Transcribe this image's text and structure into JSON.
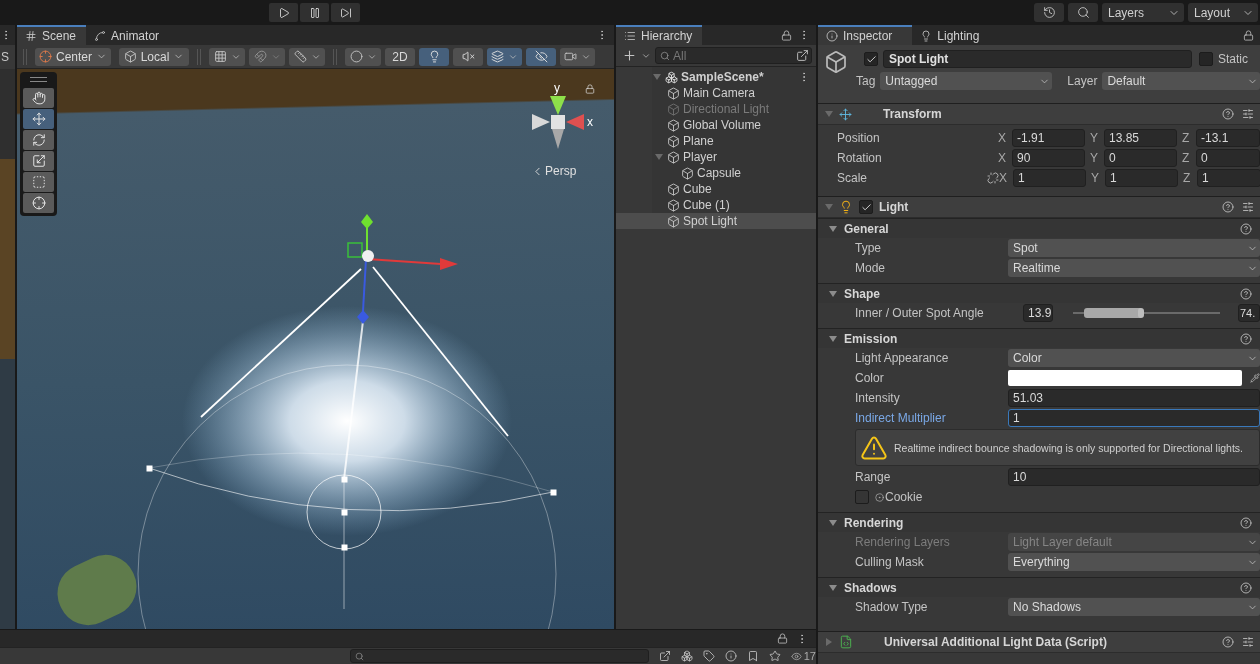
{
  "toolbar": {
    "layers": "Layers",
    "layout": "Layout"
  },
  "left_panel": {
    "tab": "S"
  },
  "scene": {
    "tabs": [
      {
        "label": "Scene",
        "selected": true
      },
      {
        "label": "Animator",
        "selected": false
      }
    ],
    "toolbar": {
      "pivot": "Center",
      "space": "Local",
      "view_2d": {
        "label": "2D",
        "on": false
      },
      "toggles": [
        {
          "kind": "lighting",
          "on": true
        },
        {
          "kind": "audio",
          "on": false
        },
        {
          "kind": "effects",
          "on": true
        },
        {
          "kind": "visibility",
          "on": true
        }
      ]
    },
    "tools": [
      {
        "kind": "hand",
        "selected": false
      },
      {
        "kind": "move",
        "selected": true
      },
      {
        "kind": "rotate",
        "selected": false
      },
      {
        "kind": "scale",
        "selected": false
      },
      {
        "kind": "rect",
        "selected": false
      },
      {
        "kind": "transform",
        "selected": false
      }
    ],
    "gizmo": {
      "y_label": "y",
      "x_label": "x",
      "projection": "Persp"
    }
  },
  "hierarchy": {
    "tab": "Hierarchy",
    "search_placeholder": "All",
    "scene": {
      "name": "SampleScene*",
      "expanded": true
    },
    "items": [
      {
        "label": "Main Camera",
        "disabled": false,
        "selected": false
      },
      {
        "label": "Directional Light",
        "disabled": true,
        "selected": false
      },
      {
        "label": "Global Volume",
        "disabled": false,
        "selected": false
      },
      {
        "label": "Plane",
        "disabled": false,
        "selected": false
      },
      {
        "label": "Player",
        "disabled": false,
        "selected": false,
        "expanded": true,
        "children": [
          {
            "label": "Capsule",
            "disabled": false,
            "selected": false
          }
        ]
      },
      {
        "label": "Cube",
        "disabled": false,
        "selected": false
      },
      {
        "label": "Cube (1)",
        "disabled": false,
        "selected": false
      },
      {
        "label": "Spot Light",
        "disabled": false,
        "selected": true
      }
    ]
  },
  "inspector": {
    "tabs": [
      {
        "label": "Inspector",
        "selected": true
      },
      {
        "label": "Lighting",
        "selected": false
      }
    ],
    "object": {
      "active": true,
      "name": "Spot Light",
      "static": false,
      "static_label": "Static",
      "tag_label": "Tag",
      "tag": "Untagged",
      "layer_label": "Layer",
      "layer": "Default"
    },
    "components": [
      {
        "kind": "transform",
        "title": "Transform",
        "expanded": true,
        "rows": [
          {
            "label": "Position",
            "values": [
              {
                "axis": "X",
                "value": "-1.91"
              },
              {
                "axis": "Y",
                "value": "13.85"
              },
              {
                "axis": "Z",
                "value": "-13.1"
              }
            ]
          },
          {
            "label": "Rotation",
            "values": [
              {
                "axis": "X",
                "value": "90"
              },
              {
                "axis": "Y",
                "value": "0"
              },
              {
                "axis": "Z",
                "value": "0"
              }
            ]
          },
          {
            "label": "Scale",
            "linked": false,
            "values": [
              {
                "axis": "X",
                "value": "1"
              },
              {
                "axis": "Y",
                "value": "1"
              },
              {
                "axis": "Z",
                "value": "1"
              }
            ]
          }
        ]
      },
      {
        "kind": "light",
        "title": "Light",
        "enabled": true,
        "expanded": true,
        "sections": [
          {
            "title": "General",
            "expanded": true,
            "rows": [
              {
                "kind": "dropdown",
                "label": "Type",
                "value": "Spot"
              },
              {
                "kind": "dropdown",
                "label": "Mode",
                "value": "Realtime"
              }
            ]
          },
          {
            "title": "Shape",
            "expanded": true,
            "rows": [
              {
                "kind": "range",
                "label": "Inner / Outer Spot Angle",
                "min": "13.9",
                "max": "74.",
                "level": 0.46
              }
            ]
          },
          {
            "title": "Emission",
            "expanded": true,
            "rows": [
              {
                "kind": "dropdown",
                "label": "Light Appearance",
                "value": "Color"
              },
              {
                "kind": "color",
                "label": "Color",
                "color": "#ffffff"
              },
              {
                "kind": "number",
                "label": "Intensity",
                "value": "51.03",
                "focused": false
              },
              {
                "kind": "number",
                "label": "Indirect Multiplier",
                "value": "1",
                "focused": true
              },
              {
                "kind": "warning",
                "text": "Realtime indirect bounce shadowing is only supported for Directional lights."
              },
              {
                "kind": "number",
                "label": "Range",
                "value": "10",
                "focused": false
              },
              {
                "kind": "object",
                "label": "Cookie",
                "checked": false
              }
            ]
          },
          {
            "title": "Rendering",
            "expanded": true,
            "rows": [
              {
                "kind": "dropdown",
                "label": "Rendering Layers",
                "value": "Light Layer default",
                "disabled": true
              },
              {
                "kind": "dropdown",
                "label": "Culling Mask",
                "value": "Everything"
              }
            ]
          },
          {
            "title": "Shadows",
            "expanded": true,
            "rows": [
              {
                "kind": "dropdown",
                "label": "Shadow Type",
                "value": "No Shadows"
              }
            ]
          }
        ]
      },
      {
        "kind": "script",
        "title": "Universal Additional Light Data (Script)",
        "expanded": false
      }
    ]
  },
  "bottom": {
    "count": "17"
  }
}
